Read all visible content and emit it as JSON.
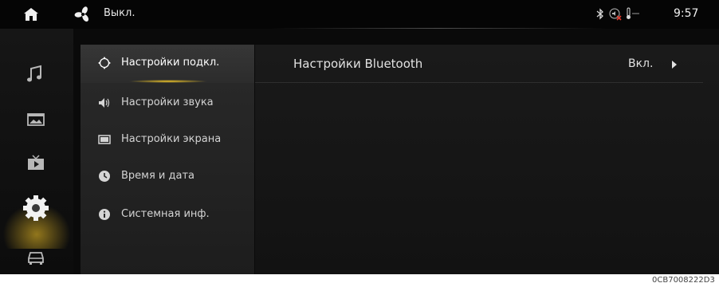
{
  "statusbar": {
    "fan_label": "Выкл.",
    "time": "9:57",
    "icons": [
      "home-icon",
      "fan-icon",
      "bluetooth-icon",
      "mute-icon",
      "temperature-icon"
    ]
  },
  "rail": {
    "items": [
      {
        "name": "music-icon"
      },
      {
        "name": "gallery-icon"
      },
      {
        "name": "video-icon"
      },
      {
        "name": "settings-icon",
        "active": true
      },
      {
        "name": "car-icon"
      }
    ]
  },
  "menu": {
    "items": [
      {
        "label": "Настройки подкл.",
        "icon": "connection-icon",
        "active": true
      },
      {
        "label": "Настройки звука",
        "icon": "speaker-icon"
      },
      {
        "label": "Настройки экрана",
        "icon": "screen-icon"
      },
      {
        "label": "Время и дата",
        "icon": "clock-icon"
      },
      {
        "label": "Системная инф.",
        "icon": "info-icon"
      }
    ]
  },
  "content": {
    "rows": [
      {
        "title": "Настройки Bluetooth",
        "value": "Вкл."
      }
    ]
  },
  "footer_code": "0CB7008222D3",
  "colors": {
    "accent": "#ffd22a",
    "background": "#0a0a0a",
    "panel": "#262626"
  }
}
